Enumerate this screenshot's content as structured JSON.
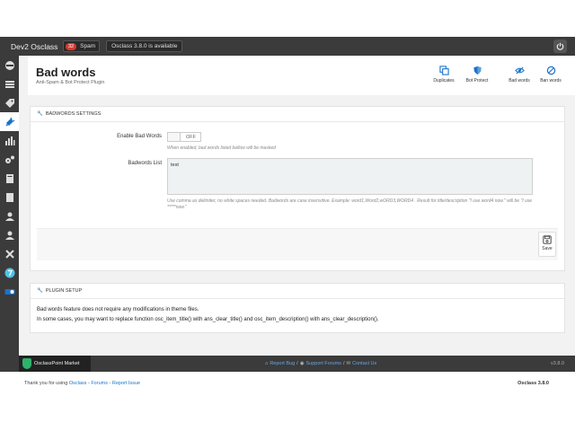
{
  "topbar": {
    "brand": "Dev2 Osclass",
    "spam_count": "32",
    "spam_label": "Spam",
    "version_notice": "Osclass 3.8.0 is available"
  },
  "header": {
    "title": "Bad words",
    "subtitle": "Anti-Spam & Bot Protect Plugin",
    "tabs": [
      {
        "label": "Duplicates",
        "icon": "duplicates-icon"
      },
      {
        "label": "Bot Protect",
        "icon": "shield-icon"
      },
      {
        "label": "Bad words",
        "icon": "eye-slash-icon"
      },
      {
        "label": "Ban words",
        "icon": "ban-icon"
      }
    ]
  },
  "settings": {
    "heading": "BADWORDS SETTINGS",
    "enable_label": "Enable Bad Words",
    "toggle_state": "OFF",
    "enable_help": "When enabled, bad words listed bellow will be masked",
    "list_label": "Badwords List",
    "list_value": "test",
    "list_help_1": "Use comma as delimiter, no white spaces needed. Badwords are case insensitive. Example: word1,Word2,wORD3,WORD4 . Result for title/description \"I use word4 now.\" will be \"I use",
    "list_help_2": "*****now.\"",
    "save_label": "Save"
  },
  "plugin_setup": {
    "heading": "PLUGIN SETUP",
    "line1": "Bad words feature does not require any modifications in theme files.",
    "line2": "In some cases, you may want to replace function osc_item_title() with ans_clear_title() and osc_item_description() with ans_clear_description()."
  },
  "footer": {
    "market": "OsclassPoint Market",
    "report_bug": "Report Bug",
    "support_forums": "Support Forums",
    "contact_us": "Contact Us",
    "sep": "/",
    "version": "v3.8.0"
  },
  "bottom": {
    "thanks": "Thank you for using",
    "osclass": "Osclass",
    "forums": "Forums",
    "report_issue": "Report Issue",
    "dash": "-",
    "version": "Osclass 3.8.0"
  },
  "colors": {
    "accent": "#1a73c8",
    "bar": "#3b3b3b",
    "spam_badge": "#d9392f"
  }
}
